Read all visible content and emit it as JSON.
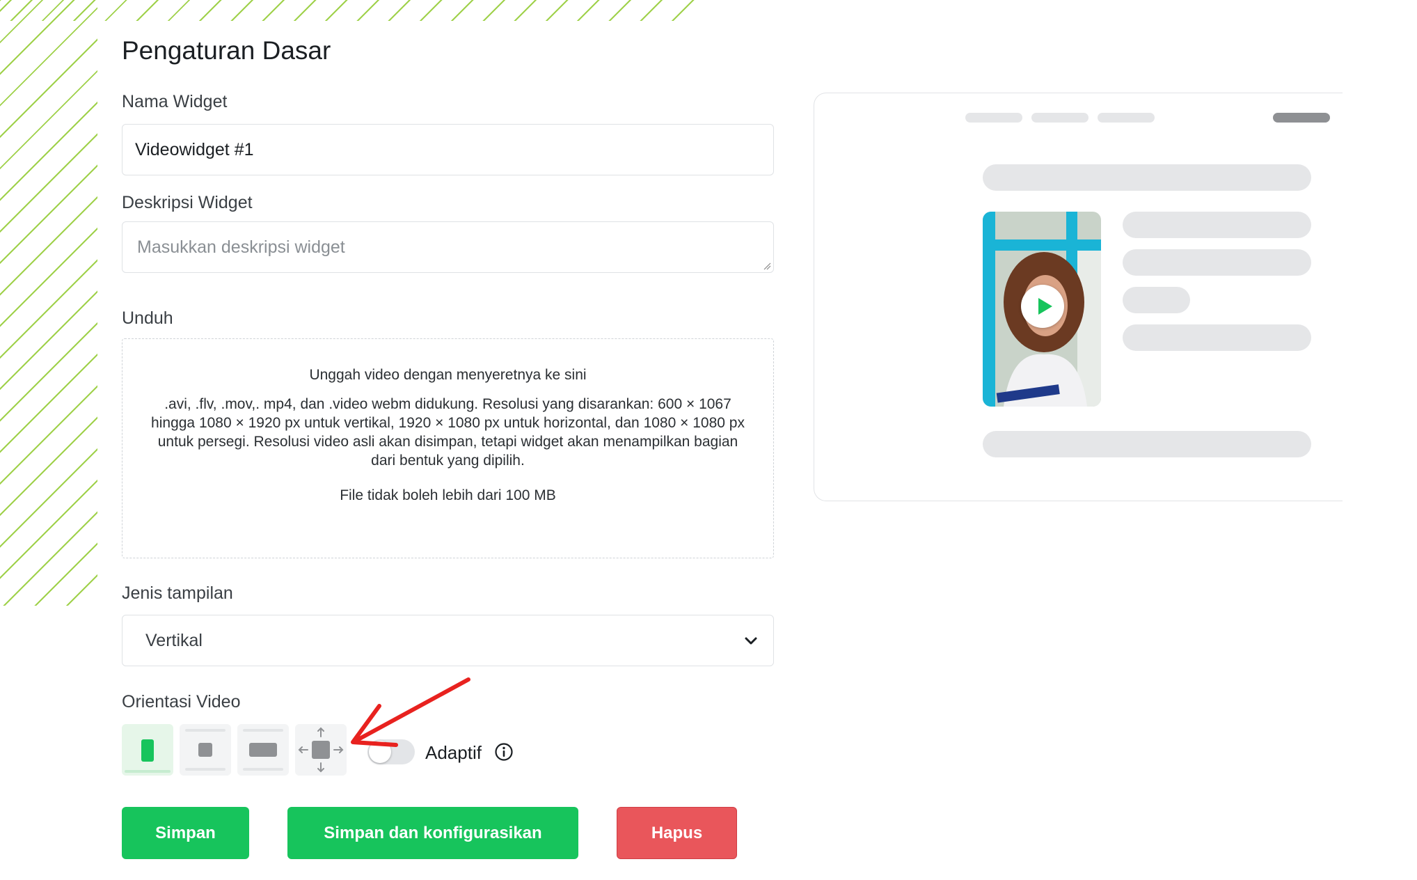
{
  "page_title": "Pengaturan Dasar",
  "fields": {
    "name_label": "Nama Widget",
    "name_value": "Videowidget #1",
    "desc_label": "Deskripsi Widget",
    "desc_placeholder": "Masukkan deskripsi widget",
    "upload_label": "Unduh",
    "display_label": "Jenis tampilan",
    "display_value": "Vertikal",
    "orientation_label": "Orientasi Video"
  },
  "dropzone": {
    "title": "Unggah video dengan menyeretnya ke sini",
    "description": ".avi, .flv, .mov,. mp4, dan .video webm didukung. Resolusi yang disarankan: 600 × 1067 hingga 1080 × 1920 px untuk vertikal, 1920 × 1080 px untuk horizontal, dan 1080 × 1080 px untuk persegi. Resolusi video asli akan disimpan, tetapi widget akan menampilkan bagian dari bentuk yang dipilih.",
    "limit": "File tidak boleh lebih dari 100 MB"
  },
  "orientation": {
    "options": [
      "vertical-icon",
      "square-icon",
      "horizontal-icon",
      "adaptive-move-icon"
    ],
    "selected": "vertical-icon",
    "adaptive_label": "Adaptif",
    "adaptive_on": false
  },
  "buttons": {
    "save": "Simpan",
    "save_configure": "Simpan dan konfigurasikan",
    "delete": "Hapus"
  },
  "colors": {
    "accent_green": "#17c45c",
    "danger_red": "#e9565b",
    "stripe_green": "#9fd14a",
    "annotation_red": "#e8221f"
  }
}
